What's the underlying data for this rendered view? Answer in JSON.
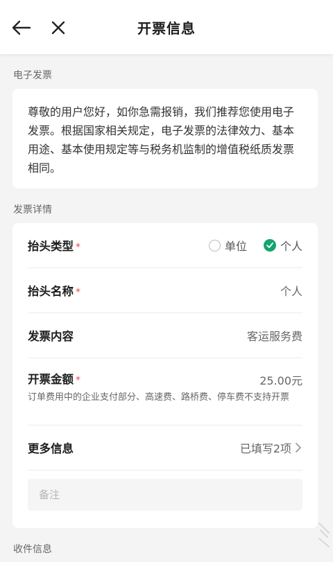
{
  "header": {
    "title": "开票信息"
  },
  "electronic_invoice": {
    "section_label": "电子发票",
    "notice": "尊敬的用户您好，如你急需报销，我们推荐您使用电子发票。根据国家相关规定，电子发票的法律效力、基本用途、基本使用规定等与税务机监制的增值税纸质发票相同。"
  },
  "invoice_details": {
    "section_label": "发票详情",
    "title_type": {
      "label": "抬头类型",
      "options": [
        "单位",
        "个人"
      ],
      "selected": "个人"
    },
    "title_name": {
      "label": "抬头名称",
      "value": "个人"
    },
    "content": {
      "label": "发票内容",
      "value": "客运服务费"
    },
    "amount": {
      "label": "开票金额",
      "value": "25.00元",
      "hint": "订单费用中的企业支付部分、高速费、路桥费、停车费不支持开票"
    },
    "more_info": {
      "label": "更多信息",
      "value": "已填写2项"
    },
    "remark": {
      "placeholder": "备注",
      "value": ""
    },
    "required_mark": "*"
  },
  "shipping": {
    "section_label": "收件信息"
  },
  "colors": {
    "accent_green": "#13a56e",
    "required_red": "#e84a4a"
  }
}
